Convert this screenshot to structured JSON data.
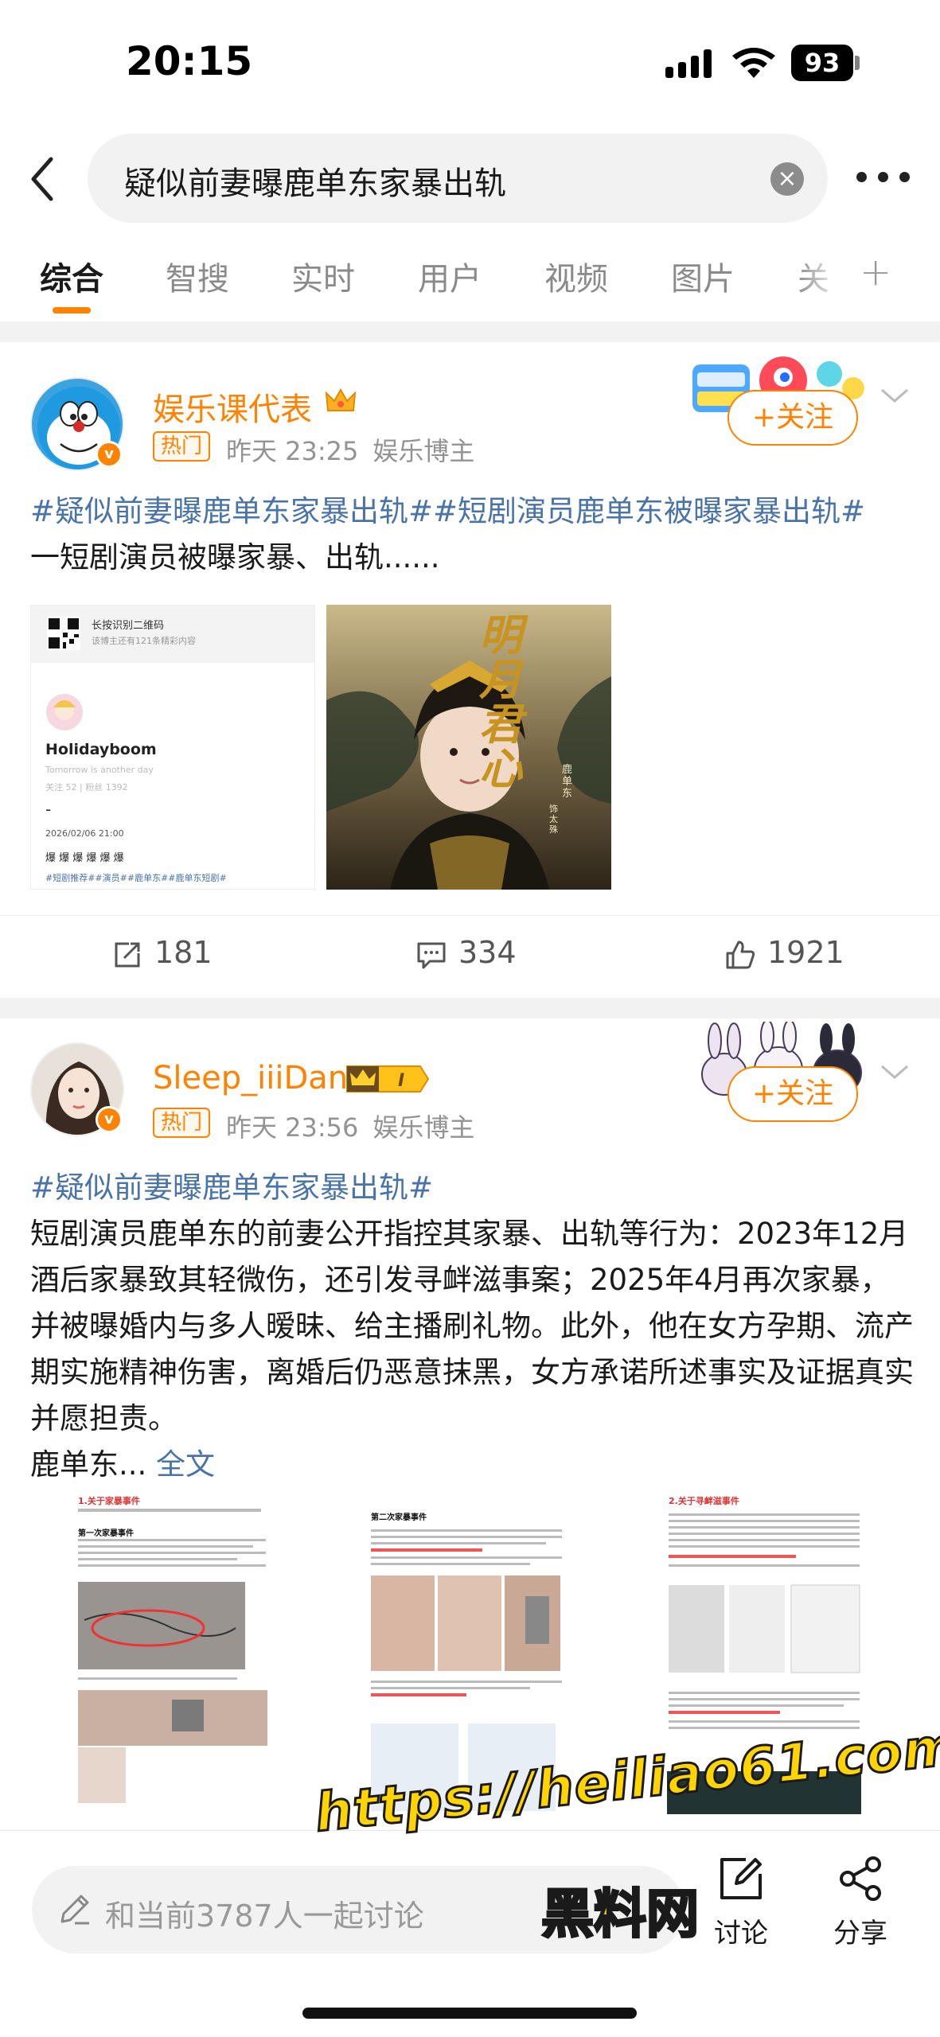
{
  "status_bar": {
    "time": "20:15",
    "battery": "93"
  },
  "search": {
    "query": "疑似前妻曝鹿单东家暴出轨"
  },
  "tabs": [
    {
      "label": "综合",
      "active": true
    },
    {
      "label": "智搜"
    },
    {
      "label": "实时"
    },
    {
      "label": "用户"
    },
    {
      "label": "视频"
    },
    {
      "label": "图片"
    },
    {
      "label": "关"
    }
  ],
  "posts": [
    {
      "username": "娱乐课代表",
      "badge": "热门",
      "time": "昨天 23:25",
      "role": "娱乐博主",
      "follow": "+关注",
      "hashtags": "#疑似前妻曝鹿单东家暴出轨##短剧演员鹿单东被曝家暴出轨#",
      "text": "一短剧演员被曝家暴、出轨......",
      "image1": {
        "qr_title": "长按识别二维码",
        "qr_sub": "该博主还有121条精彩内容",
        "profile_name": "Holidayboom",
        "profile_bio": "Tomorrow is another day",
        "profile_stats": "关注 52 | 粉丝 1392",
        "date": "2026/02/06 21:00",
        "line": "爆 爆 爆 爆 爆 爆",
        "tags": "#短剧推荐##演员##鹿单东##鹿单东短剧#"
      },
      "image2": {
        "calligraphy": "明月君心",
        "credit_name": "鹿单东",
        "credit_role": "饰 太殊"
      },
      "reposts": "181",
      "comments": "334",
      "likes": "1921"
    },
    {
      "username": "Sleep_iiiDan",
      "vip_level": "I",
      "badge": "热门",
      "time": "昨天 23:56",
      "role": "娱乐博主",
      "follow": "+关注",
      "hashtags": "#疑似前妻曝鹿单东家暴出轨#",
      "text": "短剧演员鹿单东的前妻公开指控其家暴、出轨等行为：2023年12月酒后家暴致其轻微伤，还引发寻衅滋事案；2025年4月再次家暴，并被曝婚内与多人暧昧、给主播刷礼物。此外，他在女方孕期、流产期实施精神伤害，离婚后仍恶意抹黑，女方承诺所述事实及证据真实并愿担责。",
      "preview": "鹿单东... ",
      "full_text": "全文",
      "doc1": {
        "heading": "1.关于家暴事件",
        "sub": "第一次家暴事件"
      },
      "doc2": {
        "sub": "第二次家暴事件"
      },
      "doc3": {
        "heading": "2.关于寻衅滋事件"
      }
    }
  ],
  "bottom": {
    "placeholder": "和当前3787人一起讨论",
    "discuss": "讨论",
    "share": "分享"
  },
  "watermark": {
    "url": "https://heiliao61.com",
    "name": "黑料网"
  },
  "colors": {
    "accent": "#ff8200",
    "link": "#4a73a8",
    "meta": "#939393"
  }
}
